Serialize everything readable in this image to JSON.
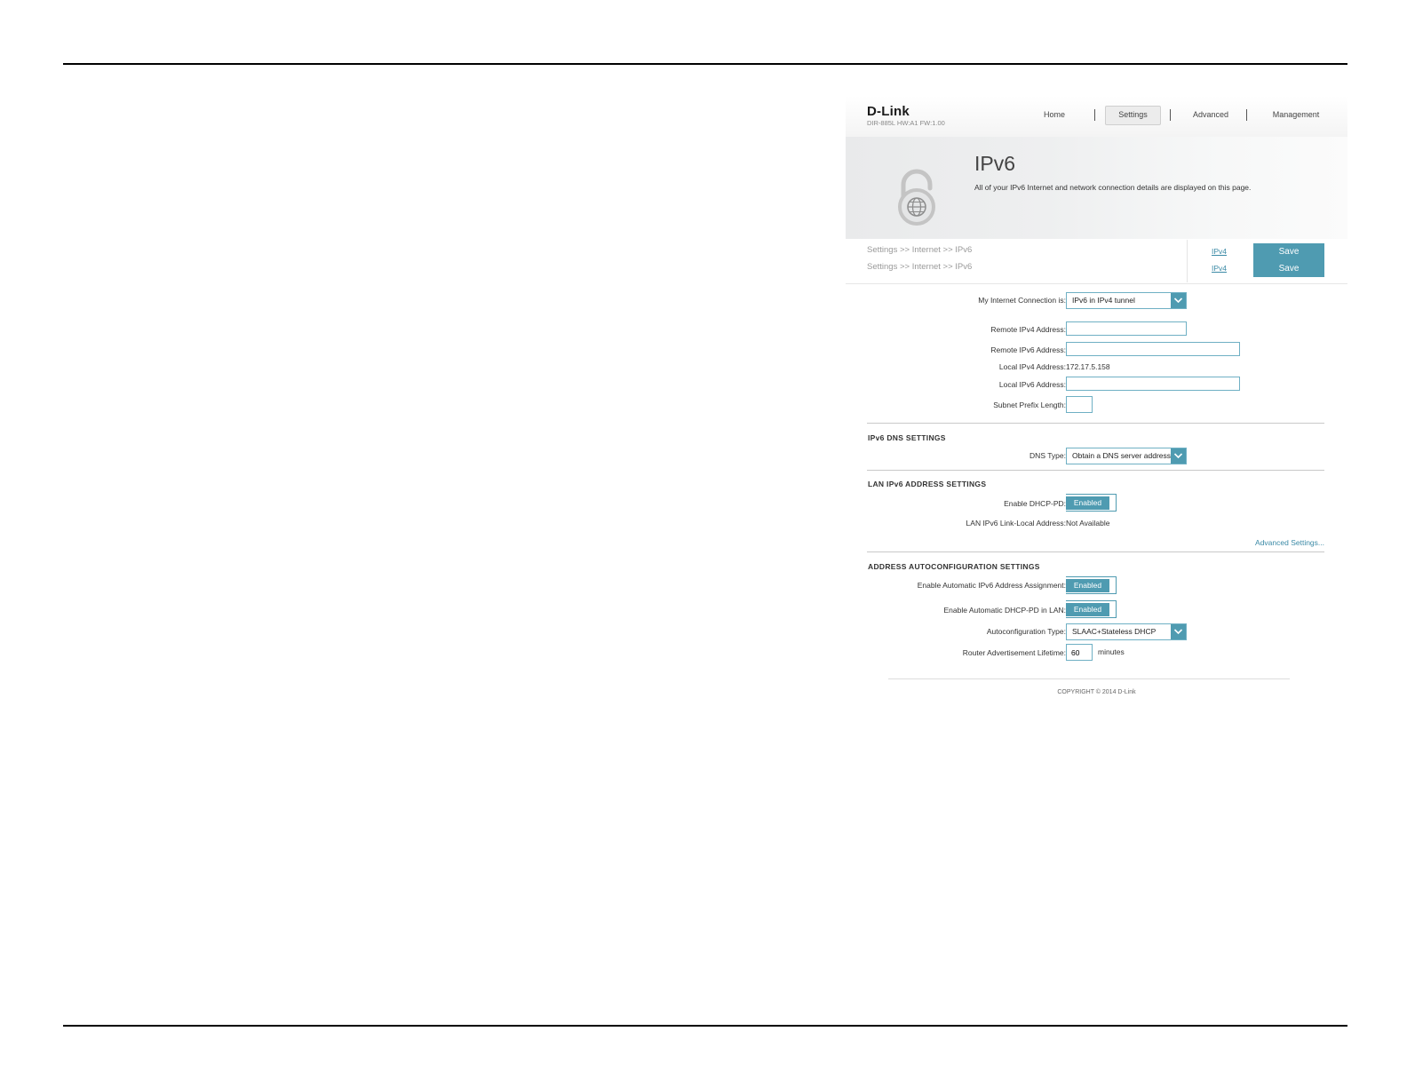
{
  "header": {
    "logo": "D-Link",
    "model": "DIR-885L  HW:A1   FW:1.00",
    "nav": [
      {
        "label": "Home",
        "active": false
      },
      {
        "label": "Settings",
        "active": true
      },
      {
        "label": "Advanced",
        "active": false
      },
      {
        "label": "Management",
        "active": false
      }
    ]
  },
  "banner": {
    "title": "IPv6",
    "description": "All of your IPv6 Internet and network connection details are displayed on this page.",
    "icon": "lock-globe-icon"
  },
  "breadcrumbs": [
    {
      "text": "Settings >> Internet >> IPv6",
      "link": "IPv4",
      "save": "Save"
    },
    {
      "text": "Settings >> Internet >> IPv6",
      "link": "IPv4",
      "save": "Save"
    }
  ],
  "connection": {
    "label": "My Internet Connection is:",
    "value": "IPv6 in IPv4 tunnel"
  },
  "fields": {
    "remote_ipv4_label": "Remote IPv4 Address:",
    "remote_ipv4_value": "",
    "remote_ipv6_label": "Remote IPv6 Address:",
    "remote_ipv6_value": "",
    "local_ipv4_label": "Local IPv4 Address:",
    "local_ipv4_value": "172.17.5.158",
    "local_ipv6_label": "Local IPv6 Address:",
    "local_ipv6_value": "",
    "prefix_label": "Subnet Prefix Length:",
    "prefix_value": ""
  },
  "dns": {
    "title": "IPv6 DNS SETTINGS",
    "type_label": "DNS Type:",
    "type_value": "Obtain a DNS server address"
  },
  "lan": {
    "title": "LAN IPv6 ADDRESS SETTINGS",
    "dhcp_pd_label": "Enable DHCP-PD:",
    "dhcp_pd_value": "Enabled",
    "link_local_label": "LAN IPv6 Link-Local Address:",
    "link_local_value": "Not Available",
    "advanced_link": "Advanced Settings..."
  },
  "autoconfig": {
    "title": "ADDRESS AUTOCONFIGURATION SETTINGS",
    "auto_assign_label": "Enable Automatic IPv6 Address Assignment:",
    "auto_assign_value": "Enabled",
    "auto_dhcp_pd_label": "Enable Automatic DHCP-PD in LAN:",
    "auto_dhcp_pd_value": "Enabled",
    "type_label": "Autoconfiguration Type:",
    "type_value": "SLAAC+Stateless DHCP",
    "lifetime_label": "Router Advertisement Lifetime:",
    "lifetime_value": "60",
    "lifetime_unit": "minutes"
  },
  "footer": {
    "copyright": "COPYRIGHT © 2014 D-Link"
  },
  "colors": {
    "accent": "#4f9bb1",
    "link": "#3b8aa6",
    "input_border": "#6fb0c4"
  }
}
